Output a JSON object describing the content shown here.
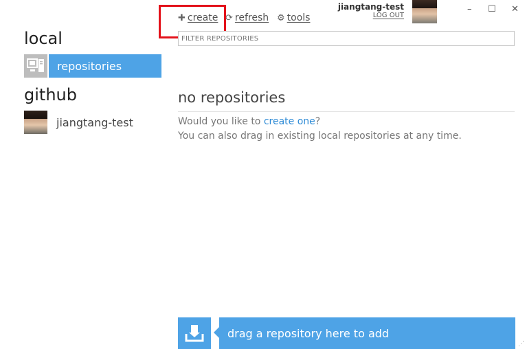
{
  "toolbar": {
    "create_label": "create",
    "refresh_label": "refresh",
    "tools_label": "tools"
  },
  "user": {
    "name": "jiangtang-test",
    "logout_label": "LOG OUT"
  },
  "window_controls": {
    "minimize": "–",
    "maximize": "☐",
    "close": "✕"
  },
  "sidebar": {
    "local_title": "local",
    "local_item_label": "repositories",
    "github_title": "github",
    "github_account": "jiangtang-test"
  },
  "main": {
    "filter_placeholder": "FILTER REPOSITORIES",
    "empty_title": "no repositories",
    "prompt_prefix": "Would you like to ",
    "prompt_link": "create one",
    "prompt_suffix": "?",
    "drag_hint": "You can also drag in existing local repositories at any time."
  },
  "dropzone": {
    "label": "drag a repository here to add"
  },
  "colors": {
    "accent": "#4ea3e6",
    "highlight": "#e3121b",
    "link": "#2e8bd6"
  }
}
